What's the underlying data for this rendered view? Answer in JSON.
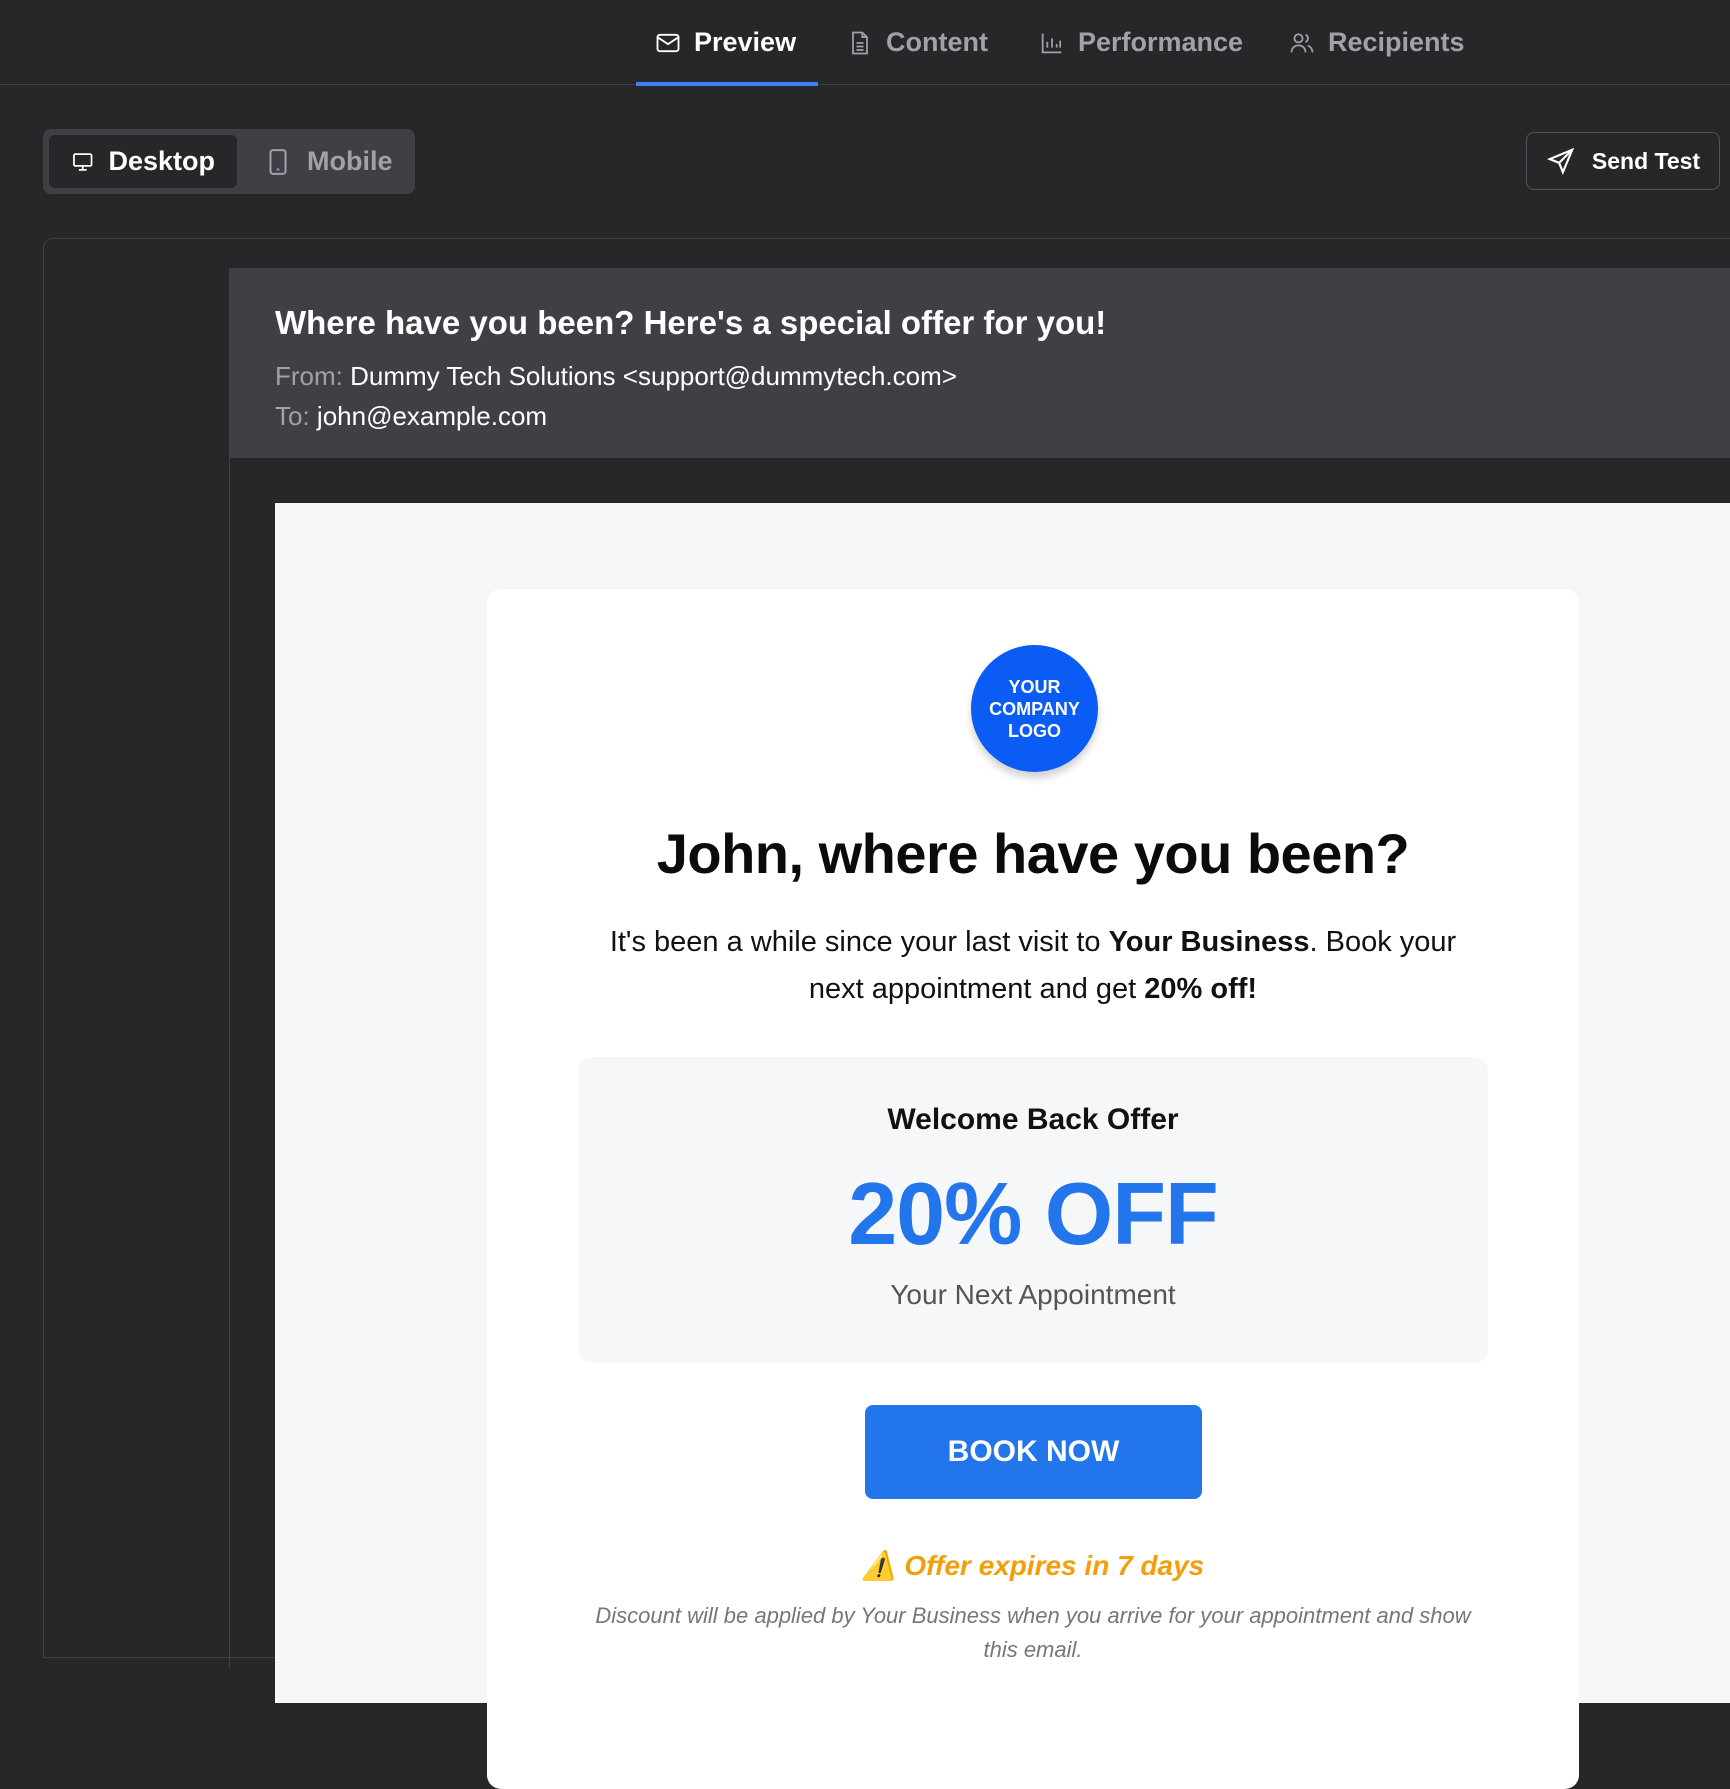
{
  "tabs": [
    {
      "label": "Preview",
      "icon": "mail-icon",
      "active": true
    },
    {
      "label": "Content",
      "icon": "document-icon",
      "active": false
    },
    {
      "label": "Performance",
      "icon": "bar-chart-icon",
      "active": false
    },
    {
      "label": "Recipients",
      "icon": "users-icon",
      "active": false
    }
  ],
  "view_toggle": {
    "desktop_label": "Desktop",
    "mobile_label": "Mobile",
    "selected": "Desktop"
  },
  "send_test_label": "Send Test",
  "email": {
    "subject": "Where have you been? Here's a special offer for you!",
    "from_label": "From:",
    "from_value": "Dummy Tech Solutions <support@dummytech.com>",
    "to_label": "To:",
    "to_value": "john@example.com"
  },
  "body": {
    "logo_text": "YOUR COMPANY LOGO",
    "headline": "John, where have you been?",
    "intro_part1": "It's been a while since your last visit to ",
    "intro_business": "Your Business",
    "intro_part2": ". Book your next appointment and get ",
    "intro_discount": "20% off!",
    "offer_title": "Welcome Back Offer",
    "offer_value": "20% OFF",
    "offer_sub": "Your Next Appointment",
    "cta_label": "BOOK NOW",
    "expires": "⚠️ Offer expires in 7 days",
    "disclaimer": "Discount will be applied by Your Business when you arrive for your appointment and show this email."
  },
  "colors": {
    "accent": "#3b82f6",
    "cta": "#2375ec",
    "logo": "#0a5cf5",
    "warning": "#f59e0b",
    "background": "#27272a"
  }
}
